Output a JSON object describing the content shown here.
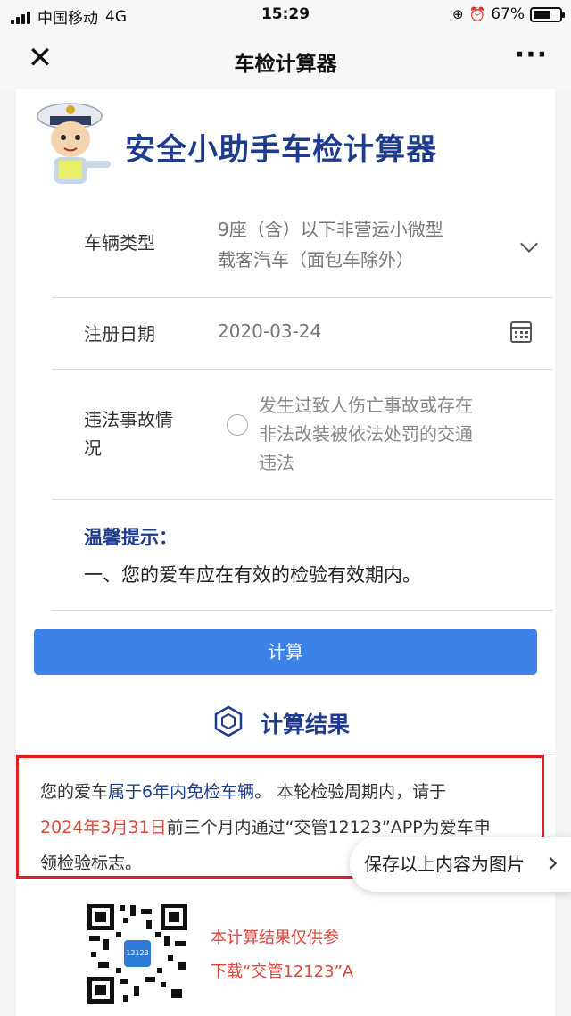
{
  "status_bar": {
    "carrier": "中国移动",
    "network": "4G",
    "time": "15:29",
    "battery": "67%",
    "battery_level": 0.67
  },
  "nav": {
    "title": "车检计算器",
    "close_icon": "close-icon",
    "more_icon": "more-icon"
  },
  "header": {
    "title": "安全小助手车检计算器"
  },
  "form": {
    "vehicle_type_label": "车辆类型",
    "vehicle_type_value_line1": "9座（含）以下非营运小微型",
    "vehicle_type_value_line2": "载客汽车（面包车除外）",
    "reg_date_label": "注册日期",
    "reg_date_value": "2020-03-24",
    "accident_label_line1": "违法事故情",
    "accident_label_line2": "况",
    "accident_option_line1": "发生过致人伤亡事故或存在",
    "accident_option_line2": "非法改装被依法处罚的交通",
    "accident_option_line3": "违法"
  },
  "tip": {
    "title": "温馨提示：",
    "text": "一、您的爱车应在有效的检验有效期内。"
  },
  "calculate_button": "计算",
  "result": {
    "title": "计算结果",
    "t1": "您的爱车",
    "t2": "属于6年内免检车辆",
    "t3": "。 本轮检验周期内，请于",
    "t4": "2024年3月31日",
    "t5": "前三个月内通过“交管12123”APP为爱车申",
    "t6": "领检验标志。"
  },
  "qr_text": "12123",
  "notes": {
    "line1": "本计算结果仅供参",
    "line2": "下载“交管12123”A"
  },
  "save_button": "保存以上内容为图片"
}
